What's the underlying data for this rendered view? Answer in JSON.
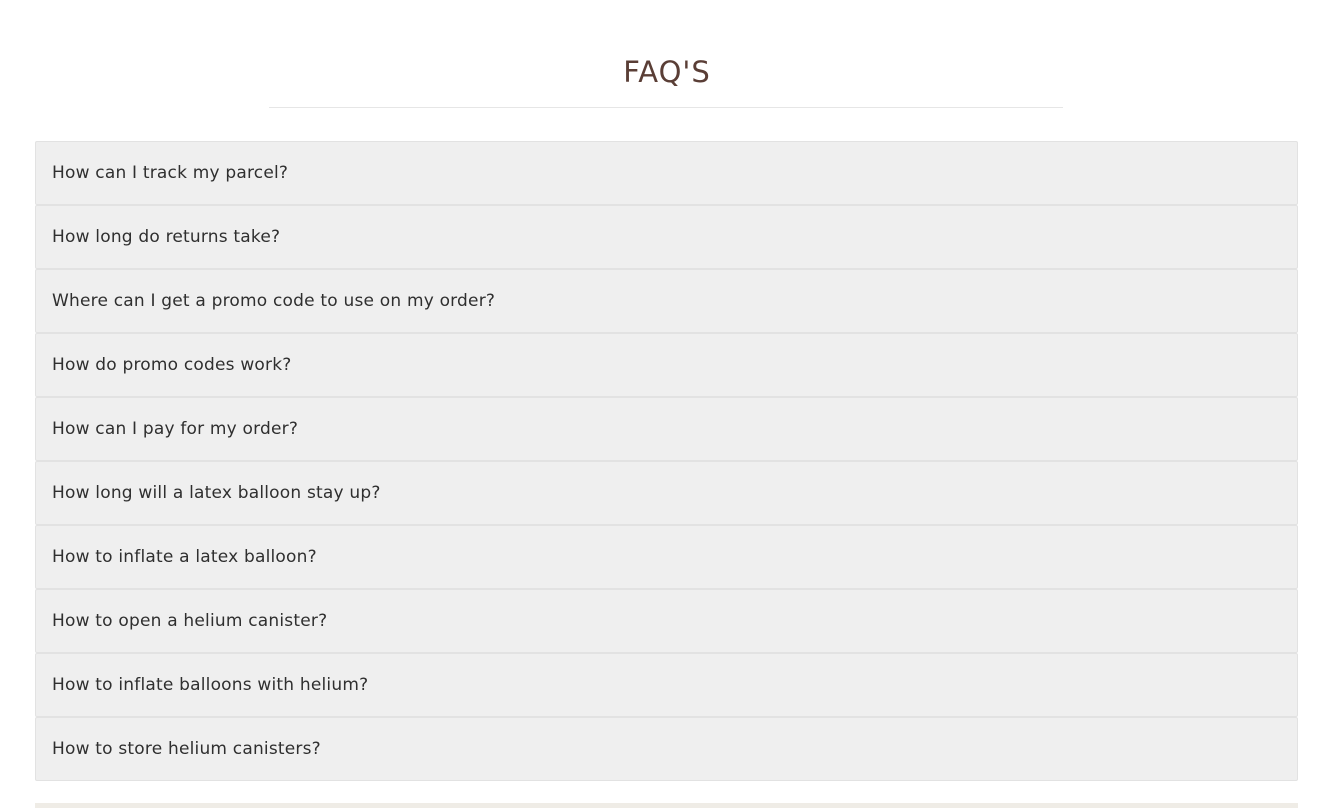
{
  "faq": {
    "title": "FAQ'S",
    "items": [
      {
        "question": "How can I track my parcel?"
      },
      {
        "question": "How long do returns take?"
      },
      {
        "question": "Where can I get a promo code to use on my order?"
      },
      {
        "question": "How do promo codes work?"
      },
      {
        "question": "How can I pay for my order?"
      },
      {
        "question": "How long will a latex balloon stay up?"
      },
      {
        "question": "How to inflate a latex balloon?"
      },
      {
        "question": "How to open a helium canister?"
      },
      {
        "question": "How to inflate balloons with helium?"
      },
      {
        "question": "How to store helium canisters?"
      }
    ]
  },
  "colors": {
    "title": "#5a3e36",
    "item_background": "#efefef"
  }
}
